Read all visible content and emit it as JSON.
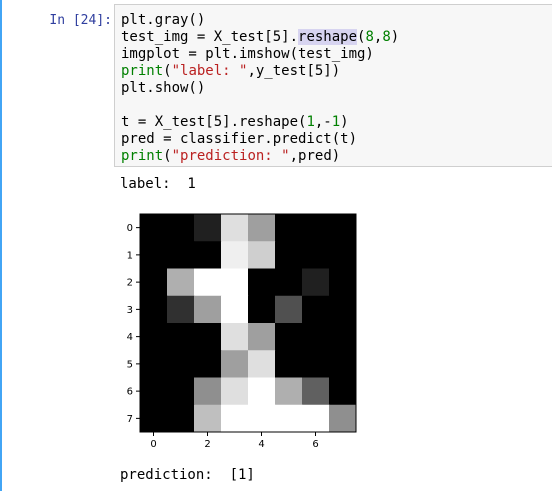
{
  "cell": {
    "prompt": "In [24]:",
    "code_lines": [
      [
        {
          "t": "plt.gray()"
        }
      ],
      [
        {
          "t": "test_img = X_test[5]."
        },
        {
          "t": "reshape",
          "c": "hl"
        },
        {
          "t": "("
        },
        {
          "t": "8",
          "c": "num"
        },
        {
          "t": ","
        },
        {
          "t": "8",
          "c": "num"
        },
        {
          "t": ")"
        }
      ],
      [
        {
          "t": "imgplot = plt.imshow(test_img)"
        }
      ],
      [
        {
          "t": "print",
          "c": "kw"
        },
        {
          "t": "("
        },
        {
          "t": "\"label: \"",
          "c": "str"
        },
        {
          "t": ",y_test[5])"
        }
      ],
      [
        {
          "t": "plt.show()"
        }
      ],
      [
        {
          "t": ""
        }
      ],
      [
        {
          "t": "t = X_test[5].reshape("
        },
        {
          "t": "1",
          "c": "num"
        },
        {
          "t": ",-"
        },
        {
          "t": "1",
          "c": "num"
        },
        {
          "t": ")"
        }
      ],
      [
        {
          "t": "pred = classifier.predict(t)"
        }
      ],
      [
        {
          "t": "print",
          "c": "kw"
        },
        {
          "t": "("
        },
        {
          "t": "\"prediction: \"",
          "c": "str"
        },
        {
          "t": ",pred)"
        }
      ]
    ]
  },
  "output": {
    "label_text": "label:  1",
    "prediction_text": "prediction:  [1]"
  },
  "chart_data": {
    "type": "heatmap",
    "colormap": "gray",
    "vmin": 0,
    "vmax": 16,
    "x_ticks": [
      0,
      2,
      4,
      6
    ],
    "y_ticks": [
      0,
      1,
      2,
      3,
      4,
      5,
      6,
      7
    ],
    "values": [
      [
        0,
        0,
        2,
        14,
        10,
        0,
        0,
        0
      ],
      [
        0,
        0,
        0,
        15,
        13,
        0,
        0,
        0
      ],
      [
        0,
        11,
        16,
        16,
        0,
        0,
        2,
        0
      ],
      [
        0,
        3,
        10,
        16,
        0,
        5,
        0,
        0
      ],
      [
        0,
        0,
        0,
        14,
        10,
        0,
        0,
        0
      ],
      [
        0,
        0,
        0,
        10,
        14,
        0,
        0,
        0
      ],
      [
        0,
        0,
        9,
        14,
        16,
        11,
        6,
        0
      ],
      [
        0,
        0,
        12,
        16,
        16,
        16,
        16,
        9
      ]
    ]
  }
}
